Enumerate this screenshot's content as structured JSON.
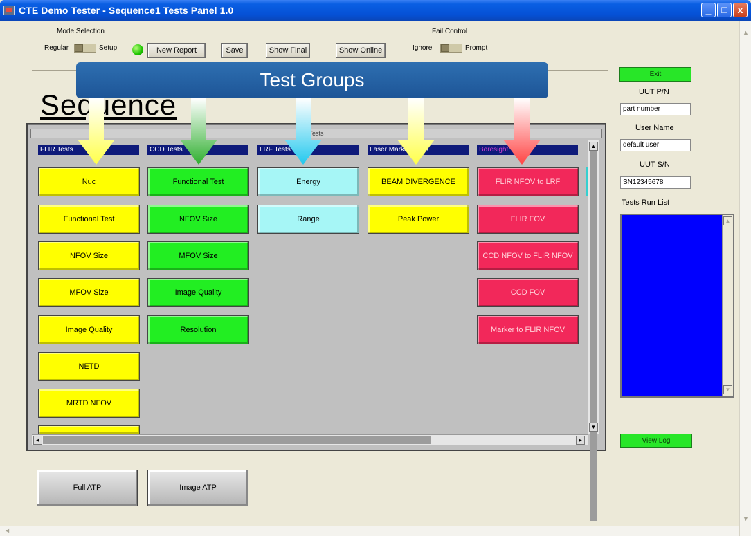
{
  "window": {
    "title": "CTE Demo Tester - Sequence1 Tests Panel 1.0",
    "controls": [
      "_",
      "□",
      "x"
    ]
  },
  "mode_selection": {
    "label": "Mode Selection",
    "left_option": "Regular",
    "right_option": "Setup"
  },
  "toolbar": {
    "new_report": "New Report",
    "save": "Save",
    "show_final": "Show Final",
    "show_online": "Show Online"
  },
  "fail_control": {
    "label": "Fail Control",
    "left_option": "Ignore",
    "right_option": "Prompt"
  },
  "sequence_title": "Sequence",
  "banner": {
    "text": "Test Groups",
    "color": "#1f5fa6"
  },
  "tests_panel": {
    "header": "Tests"
  },
  "groups": [
    {
      "name": "FLIR Tests",
      "color": "#ffff00",
      "arrow_color": "#ffff66",
      "tests": [
        "Nuc",
        "Functional Test",
        "NFOV Size",
        "MFOV Size",
        "Image Quality",
        "NETD",
        "MRTD NFOV",
        ""
      ]
    },
    {
      "name": "CCD Tests",
      "color": "#22ee22",
      "arrow_color": "#33bb33",
      "tests": [
        "Functional Test",
        "NFOV Size",
        "MFOV Size",
        "Image Quality",
        "Resolution"
      ]
    },
    {
      "name": "LRF Tests",
      "color": "#a6f6f6",
      "arrow_color": "#33ccee",
      "tests": [
        "Energy",
        "Range"
      ]
    },
    {
      "name": "Laser Marker Tests",
      "color": "#ffff00",
      "arrow_color": "#ffff66",
      "tests": [
        "BEAM DIVERGENCE",
        "Peak Power"
      ]
    },
    {
      "name": "Boresight",
      "color": "#f2285a",
      "arrow_color": "#ff5555",
      "tests": [
        "FLIR NFOV to LRF",
        "FLIR FOV",
        "CCD NFOV to FLIR NFOV",
        "CCD FOV",
        "Marker to FLIR NFOV"
      ]
    }
  ],
  "right_panel": {
    "exit": "Exit",
    "uut_pn_label": "UUT P/N",
    "uut_pn_value": "part number",
    "user_name_label": "User Name",
    "user_name_value": "default user",
    "uut_sn_label": "UUT S/N",
    "uut_sn_value": "SN12345678",
    "tests_run_list_label": "Tests Run List",
    "view_log": "View Log"
  },
  "bottom_buttons": {
    "full_atp": "Full ATP",
    "image_atp": "Image ATP"
  }
}
